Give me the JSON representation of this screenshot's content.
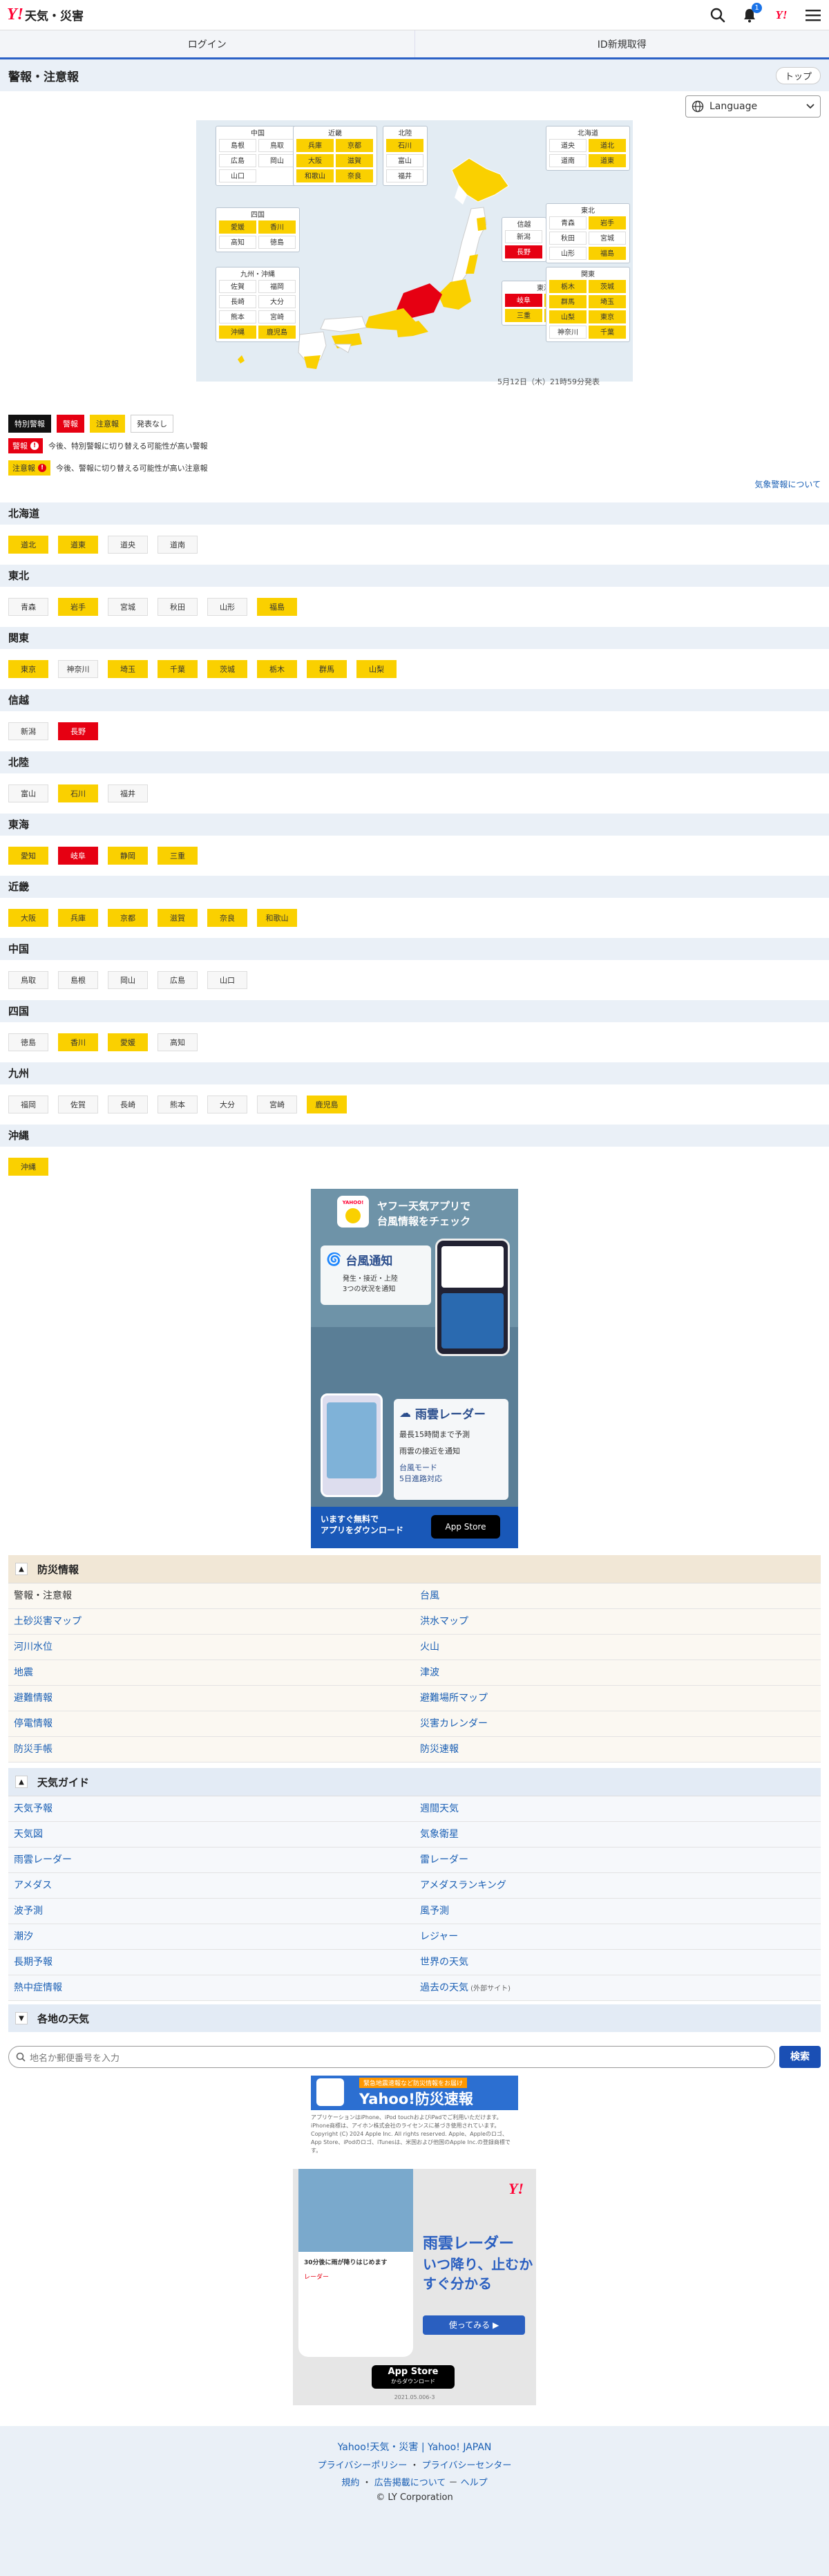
{
  "header": {
    "logo_y": "Y!",
    "logo_text": "天気・災害",
    "badge": "1",
    "ybox": "Y!"
  },
  "auth": {
    "login": "ログイン",
    "signup": "ID新規取得"
  },
  "page": {
    "title": "警報・注意報",
    "top_button": "トップ"
  },
  "language": {
    "label": "Language"
  },
  "map": {
    "issued": "5月12日（木）21時59分発表",
    "groups": [
      {
        "title": "中国",
        "cells": [
          {
            "name": "島根",
            "s": "n"
          },
          {
            "name": "鳥取",
            "s": "n"
          },
          {
            "name": "広島",
            "s": "n"
          },
          {
            "name": "岡山",
            "s": "n"
          },
          {
            "name": "山口",
            "s": "n"
          }
        ]
      },
      {
        "title": "近畿",
        "cells": [
          {
            "name": "兵庫",
            "s": "y"
          },
          {
            "name": "京都",
            "s": "y"
          },
          {
            "name": "大阪",
            "s": "y"
          },
          {
            "name": "滋賀",
            "s": "y"
          },
          {
            "name": "和歌山",
            "s": "y"
          },
          {
            "name": "奈良",
            "s": "y"
          }
        ]
      },
      {
        "title": "北陸",
        "cells": [
          {
            "name": "石川",
            "s": "y"
          },
          {
            "name": "富山",
            "s": "n"
          },
          {
            "name": "福井",
            "s": "n"
          }
        ]
      },
      {
        "title": "北海道",
        "cells": [
          {
            "name": "道央",
            "s": "n"
          },
          {
            "name": "道北",
            "s": "y"
          },
          {
            "name": "道南",
            "s": "n"
          },
          {
            "name": "道東",
            "s": "y"
          }
        ]
      },
      {
        "title": "四国",
        "cells": [
          {
            "name": "愛媛",
            "s": "y"
          },
          {
            "name": "香川",
            "s": "y"
          },
          {
            "name": "高知",
            "s": "n"
          },
          {
            "name": "徳島",
            "s": "n"
          }
        ]
      },
      {
        "title": "信越",
        "cells": [
          {
            "name": "新潟",
            "s": "n"
          },
          {
            "name": "長野",
            "s": "r"
          }
        ]
      },
      {
        "title": "東北",
        "cells": [
          {
            "name": "青森",
            "s": "n"
          },
          {
            "name": "岩手",
            "s": "y"
          },
          {
            "name": "秋田",
            "s": "n"
          },
          {
            "name": "宮城",
            "s": "n"
          },
          {
            "name": "山形",
            "s": "n"
          },
          {
            "name": "福島",
            "s": "y"
          }
        ]
      },
      {
        "title": "九州・沖縄",
        "cells": [
          {
            "name": "佐賀",
            "s": "n"
          },
          {
            "name": "福岡",
            "s": "n"
          },
          {
            "name": "長崎",
            "s": "n"
          },
          {
            "name": "大分",
            "s": "n"
          },
          {
            "name": "熊本",
            "s": "n"
          },
          {
            "name": "宮崎",
            "s": "n"
          },
          {
            "name": "沖縄",
            "s": "y"
          },
          {
            "name": "鹿児島",
            "s": "y"
          }
        ]
      },
      {
        "title": "東海",
        "cells": [
          {
            "name": "岐阜",
            "s": "r"
          },
          {
            "name": "静岡",
            "s": "y"
          },
          {
            "name": "三重",
            "s": "y"
          },
          {
            "name": "愛知",
            "s": "y"
          }
        ]
      },
      {
        "title": "関東",
        "cells": [
          {
            "name": "栃木",
            "s": "y"
          },
          {
            "name": "茨城",
            "s": "y"
          },
          {
            "name": "群馬",
            "s": "y"
          },
          {
            "name": "埼玉",
            "s": "y"
          },
          {
            "name": "山梨",
            "s": "y"
          },
          {
            "name": "東京",
            "s": "y"
          },
          {
            "name": "神奈川",
            "s": "n"
          },
          {
            "name": "千葉",
            "s": "y"
          }
        ]
      }
    ]
  },
  "legend": {
    "special": "特別警報",
    "warning": "警報",
    "advisory": "注意報",
    "none": "発表なし",
    "warn_tag": "警報",
    "warn_note": "今後、特別警報に切り替える可能性が高い警報",
    "adv_tag": "注意報",
    "adv_note": "今後、警報に切り替える可能性が高い注意報",
    "about": "気象警報について"
  },
  "regions": [
    {
      "name": "北海道",
      "prefs": [
        {
          "n": "道北",
          "s": "y"
        },
        {
          "n": "道東",
          "s": "y"
        },
        {
          "n": "道央",
          "s": "n"
        },
        {
          "n": "道南",
          "s": "n"
        }
      ]
    },
    {
      "name": "東北",
      "prefs": [
        {
          "n": "青森",
          "s": "n"
        },
        {
          "n": "岩手",
          "s": "y"
        },
        {
          "n": "宮城",
          "s": "n"
        },
        {
          "n": "秋田",
          "s": "n"
        },
        {
          "n": "山形",
          "s": "n"
        },
        {
          "n": "福島",
          "s": "y"
        }
      ]
    },
    {
      "name": "関東",
      "prefs": [
        {
          "n": "東京",
          "s": "y"
        },
        {
          "n": "神奈川",
          "s": "n"
        },
        {
          "n": "埼玉",
          "s": "y"
        },
        {
          "n": "千葉",
          "s": "y"
        },
        {
          "n": "茨城",
          "s": "y"
        },
        {
          "n": "栃木",
          "s": "y"
        },
        {
          "n": "群馬",
          "s": "y"
        },
        {
          "n": "山梨",
          "s": "y"
        }
      ]
    },
    {
      "name": "信越",
      "prefs": [
        {
          "n": "新潟",
          "s": "n"
        },
        {
          "n": "長野",
          "s": "r"
        }
      ]
    },
    {
      "name": "北陸",
      "prefs": [
        {
          "n": "富山",
          "s": "n"
        },
        {
          "n": "石川",
          "s": "y"
        },
        {
          "n": "福井",
          "s": "n"
        }
      ]
    },
    {
      "name": "東海",
      "prefs": [
        {
          "n": "愛知",
          "s": "y"
        },
        {
          "n": "岐阜",
          "s": "r"
        },
        {
          "n": "静岡",
          "s": "y"
        },
        {
          "n": "三重",
          "s": "y"
        }
      ]
    },
    {
      "name": "近畿",
      "prefs": [
        {
          "n": "大阪",
          "s": "y"
        },
        {
          "n": "兵庫",
          "s": "y"
        },
        {
          "n": "京都",
          "s": "y"
        },
        {
          "n": "滋賀",
          "s": "y"
        },
        {
          "n": "奈良",
          "s": "y"
        },
        {
          "n": "和歌山",
          "s": "y"
        }
      ]
    },
    {
      "name": "中国",
      "prefs": [
        {
          "n": "鳥取",
          "s": "n"
        },
        {
          "n": "島根",
          "s": "n"
        },
        {
          "n": "岡山",
          "s": "n"
        },
        {
          "n": "広島",
          "s": "n"
        },
        {
          "n": "山口",
          "s": "n"
        }
      ]
    },
    {
      "name": "四国",
      "prefs": [
        {
          "n": "徳島",
          "s": "n"
        },
        {
          "n": "香川",
          "s": "y"
        },
        {
          "n": "愛媛",
          "s": "y"
        },
        {
          "n": "高知",
          "s": "n"
        }
      ]
    },
    {
      "name": "九州",
      "prefs": [
        {
          "n": "福岡",
          "s": "n"
        },
        {
          "n": "佐賀",
          "s": "n"
        },
        {
          "n": "長崎",
          "s": "n"
        },
        {
          "n": "熊本",
          "s": "n"
        },
        {
          "n": "大分",
          "s": "n"
        },
        {
          "n": "宮崎",
          "s": "n"
        },
        {
          "n": "鹿児島",
          "s": "y"
        }
      ]
    },
    {
      "name": "沖縄",
      "prefs": [
        {
          "n": "沖縄",
          "s": "y"
        }
      ]
    }
  ],
  "ad1": {
    "title": "ヤフー天気アプリで\n台風情報をチェック",
    "badge": "YAHOO!",
    "notify": "台風通知",
    "notify_sub": "発生・接近・上陸\n3つの状況を通知",
    "radar": "雨雲レーダー",
    "r1": "最長15時間まで予測",
    "r2": "雨雲の接近を通知",
    "r3": "台風モード\n5日進路対応",
    "cta": "いますぐ無料で\nアプリをダウンロード",
    "store": "App Store"
  },
  "bosai": {
    "title": "防災情報",
    "items": [
      "警報・注意報",
      "台風",
      "土砂災害マップ",
      "洪水マップ",
      "河川水位",
      "火山",
      "地震",
      "津波",
      "避難情報",
      "避難場所マップ",
      "停電情報",
      "災害カレンダー",
      "防災手帳",
      "防災速報"
    ]
  },
  "guide": {
    "title": "天気ガイド",
    "items": [
      "天気予報",
      "週間天気",
      "天気図",
      "気象衛星",
      "雨雲レーダー",
      "雷レーダー",
      "アメダス",
      "アメダスランキング",
      "波予測",
      "風予測",
      "潮汐",
      "レジャー",
      "長期予報",
      "世界の天気",
      "熱中症情報",
      "過去の天気"
    ],
    "past_note": "(外部サイト)"
  },
  "local": {
    "title": "各地の天気"
  },
  "search": {
    "placeholder": "地名か郵便番号を入力",
    "button": "検索"
  },
  "ad2": {
    "head": "緊急地震速報など防災情報をお届け",
    "title": "Yahoo!防災速報",
    "small": "アプリケーションはiPhone、iPod touchおよびiPadでご利用いただけます。iPhone商標は、アイホン株式会社のライセンスに基づき使用されています。Copyright (C) 2024 Apple Inc. All rights reserved. Apple、Appleのロゴ、App Store、iPodのロゴ、iTunesは、米国および他国のApple Inc.の登録商標です。",
    "r_title": "雨雲レーダー",
    "r_sub": "いつ降り、止むか\nすぐ分かる",
    "r_btn": "使ってみる ▶",
    "phone_a": "30分後に雨が降りはじめます",
    "phone_b": "レーダー",
    "store": "App Store",
    "store_sub": "からダウンロード",
    "version": "2021.05.006-3"
  },
  "footer": {
    "title": "Yahoo!天気・災害 | Yahoo! JAPAN",
    "l1": "プライバシーポリシー",
    "l2": "プライバシーセンター",
    "l3": "規約",
    "l4": "広告掲載について",
    "l5": "ヘルプ",
    "copy": "© LY Corporation",
    "sep": "－",
    "sep2": "・"
  }
}
